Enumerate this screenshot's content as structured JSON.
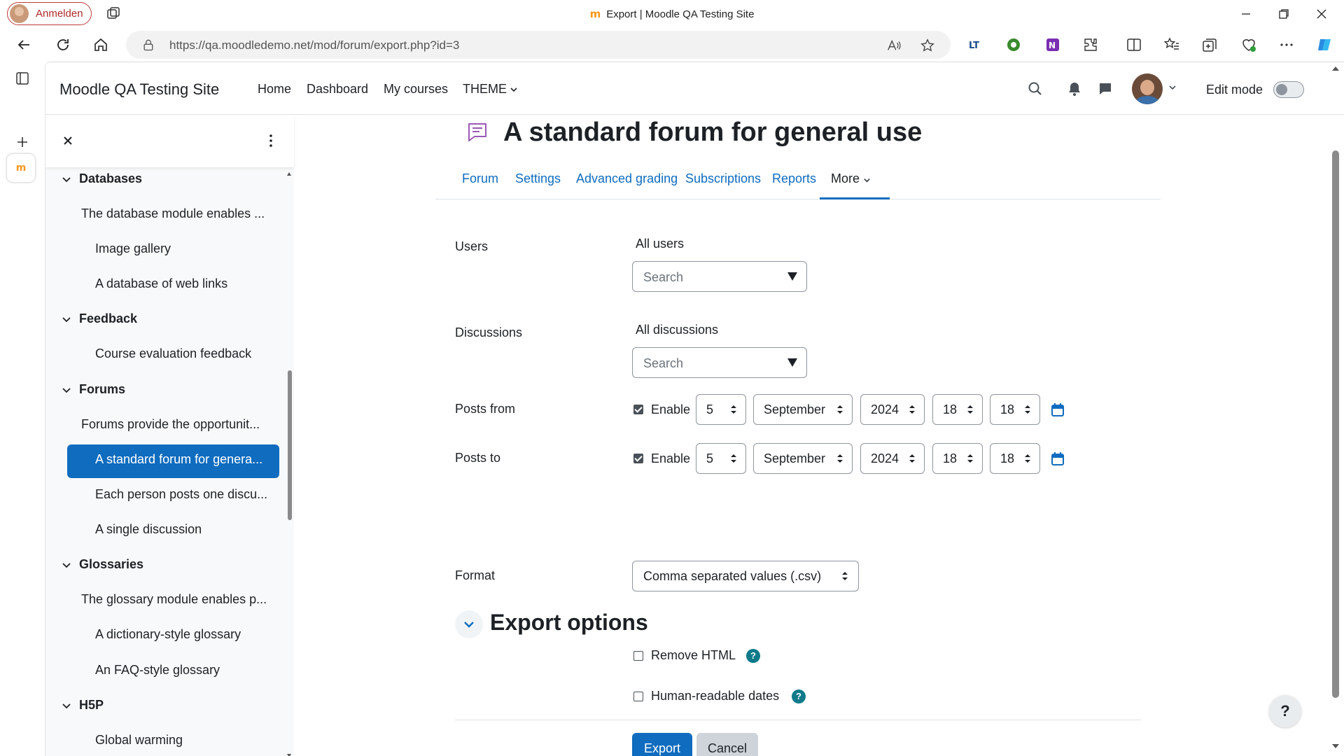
{
  "browser": {
    "profile_label": "Anmelden",
    "window_title": "Export | Moodle QA Testing Site",
    "url": "https://qa.moodledemo.net/mod/forum/export.php?id=3",
    "favicon_text": "m"
  },
  "navbar": {
    "site_name": "Moodle QA Testing Site",
    "links": [
      "Home",
      "Dashboard",
      "My courses",
      "THEME"
    ],
    "edit_mode_label": "Edit mode"
  },
  "course_index": {
    "sections": [
      {
        "label": "Databases"
      },
      {
        "label": "Feedback"
      },
      {
        "label": "Forums"
      },
      {
        "label": "Glossaries"
      },
      {
        "label": "H5P"
      }
    ],
    "items": [
      "The database module enables ...",
      "Image gallery",
      "A database of web links",
      "Course evaluation feedback",
      "Forums provide the opportunit...",
      "A standard forum for genera...",
      "Each person posts one discu...",
      "A single discussion",
      "The glossary module enables p...",
      "A dictionary-style glossary",
      "An FAQ-style glossary",
      "Global warming"
    ]
  },
  "page": {
    "title": "A standard forum for general use",
    "tabs": [
      "Forum",
      "Settings",
      "Advanced grading",
      "Subscriptions",
      "Reports",
      "More"
    ],
    "active_tab": "More"
  },
  "form": {
    "users_label": "Users",
    "users_value": "All users",
    "search_placeholder": "Search",
    "discussions_label": "Discussions",
    "discussions_value": "All discussions",
    "posts_from_label": "Posts from",
    "posts_to_label": "Posts to",
    "enable_label": "Enable",
    "date": {
      "day": "5",
      "month": "September",
      "year": "2024",
      "hour": "18",
      "minute": "18"
    },
    "format_label": "Format",
    "format_value": "Comma separated values (.csv)",
    "export_options_title": "Export options",
    "remove_html_label": "Remove HTML",
    "human_dates_label": "Human-readable dates",
    "export_button": "Export",
    "cancel_button": "Cancel",
    "help_glyph": "?"
  },
  "colors": {
    "brand": "#0f6cbf",
    "help": "#0e7a8a",
    "forum_icon": "#9b59b6"
  },
  "icons": {
    "title": "forum-icon",
    "back": "arrow-left-icon",
    "refresh": "refresh-icon",
    "home": "home-icon"
  }
}
